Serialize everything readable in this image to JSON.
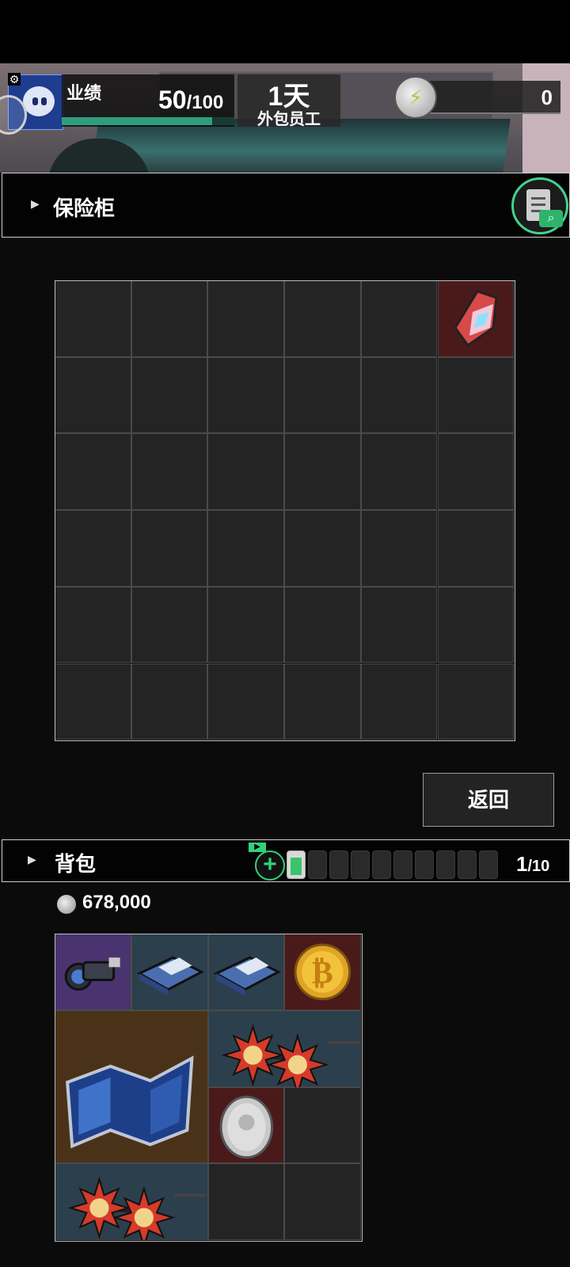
{
  "header": {
    "performance_label": "业绩",
    "performance_current": "50",
    "performance_max": "/100",
    "performance_progress": 0.5,
    "day_value": "1天",
    "job_title": "外包员工",
    "energy_value": "0"
  },
  "safe": {
    "title": "保险柜",
    "grid_cols": 6,
    "grid_rows": 6,
    "items": [
      {
        "name": "crystal-shard",
        "icon": "prism-crystal-icon",
        "row": 0,
        "col": 5,
        "bg": "#4a1a1a"
      }
    ],
    "back_label": "返回"
  },
  "bag": {
    "title": "背包",
    "battery_slots": 10,
    "battery_filled": 1,
    "count_current": "1",
    "count_max": "/10",
    "money": "678,000",
    "items": [
      {
        "name": "scope",
        "icon": "scope-icon",
        "bg": "#4a3470"
      },
      {
        "name": "data-chip-1",
        "icon": "data-chip-icon",
        "bg": "#2c3f4c"
      },
      {
        "name": "data-chip-2",
        "icon": "data-chip-icon",
        "bg": "#2c3f4c"
      },
      {
        "name": "gold-bitcoin",
        "icon": "bitcoin-icon",
        "bg": "#4a1a1a"
      },
      {
        "name": "star-map",
        "icon": "map-icon",
        "bg": "#4a3218"
      },
      {
        "name": "sun-glasses-1",
        "icon": "sun-glasses-icon",
        "bg": "#2c3f4c"
      },
      {
        "name": "silver-coin",
        "icon": "silver-coin-icon",
        "bg": "#4a1a1a"
      },
      {
        "name": "sun-glasses-2",
        "icon": "sun-glasses-icon",
        "bg": "#2c3f4c"
      }
    ]
  }
}
